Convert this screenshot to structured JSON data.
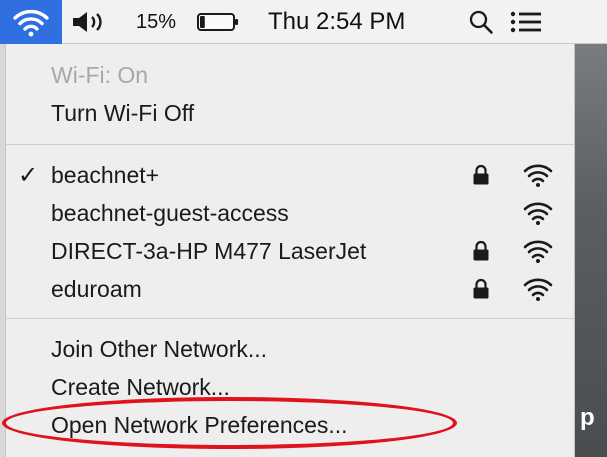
{
  "menubar": {
    "wifi_icon": "wifi-icon",
    "volume_icon": "speaker-volume-icon",
    "battery_percent": "15%",
    "battery_level": 0.15,
    "battery_icon": "battery-icon",
    "clock": "Thu 2:54 PM",
    "search_icon": "spotlight-search-icon",
    "list_icon": "notification-center-icon",
    "accent_color": "#2f6fe0"
  },
  "menu": {
    "status": "Wi-Fi: On",
    "toggle": "Turn Wi-Fi Off",
    "networks": [
      {
        "name": "beachnet+",
        "selected": true,
        "locked": true
      },
      {
        "name": "beachnet-guest-access",
        "selected": false,
        "locked": false
      },
      {
        "name": "DIRECT-3a-HP M477 LaserJet",
        "selected": false,
        "locked": true
      },
      {
        "name": "eduroam",
        "selected": false,
        "locked": true
      }
    ],
    "join_other": "Join Other Network...",
    "create": "Create Network...",
    "open_prefs": "Open Network Preferences..."
  },
  "annotation": {
    "highlight_color": "#e0121b"
  },
  "desktop": {
    "peek_text": "p"
  }
}
